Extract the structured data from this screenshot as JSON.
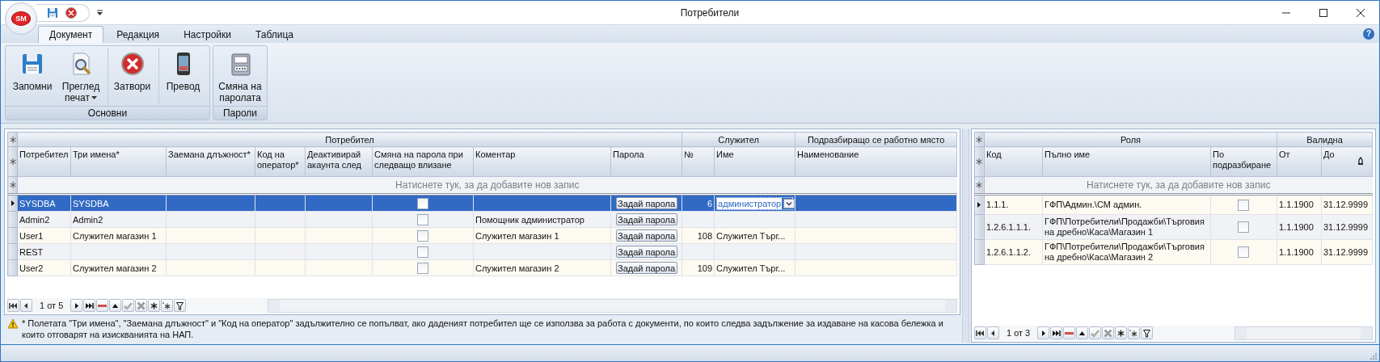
{
  "window": {
    "title": "Потребители"
  },
  "app_button": {
    "label": "SM"
  },
  "help_button": {
    "label": "?"
  },
  "tabs": [
    {
      "label": "Документ",
      "selected": true
    },
    {
      "label": "Редакция",
      "selected": false
    },
    {
      "label": "Настройки",
      "selected": false
    },
    {
      "label": "Таблица",
      "selected": false
    }
  ],
  "ribbon_groups": [
    {
      "title": "Основни",
      "buttons": [
        {
          "label": "Запомни",
          "dropdown": false,
          "separator_before": false
        },
        {
          "label": "Преглед печат",
          "dropdown": true,
          "separator_before": false
        },
        {
          "label": "Затвори",
          "dropdown": false,
          "separator_before": true
        },
        {
          "label": "Превод",
          "dropdown": false,
          "separator_before": true
        }
      ]
    },
    {
      "title": "Пароли",
      "buttons": [
        {
          "label": "Смяна на паролата",
          "dropdown": false,
          "separator_before": false
        }
      ]
    }
  ],
  "users_grid": {
    "column_groups": [
      {
        "label": "Потребител",
        "columns": [
          "Потребител",
          "Три имена*",
          "Заемана длъжност*",
          "Код на оператор*",
          "Деактивирай акаунта след",
          "Смяна на парола при следващо влизане",
          "Коментар",
          "Парола"
        ]
      },
      {
        "label": "Служител",
        "columns": [
          "№",
          "Име"
        ]
      },
      {
        "label": "Подразбиращо се работно място",
        "columns": [
          "Наименование"
        ]
      }
    ],
    "new_row_prompt": "Натиснете тук, за да добавите нов запис",
    "rows": [
      {
        "current": true,
        "selected": true,
        "editing": true,
        "user": "SYSDBA",
        "full_name": "SYSDBA",
        "change_password": false,
        "password_button": "Задай парола",
        "number": "6",
        "employee_name": "администратор"
      },
      {
        "current": false,
        "selected": false,
        "editing": false,
        "user": "Admin2",
        "full_name": "Admin2",
        "change_password": false,
        "comment": "Помощник администратор",
        "password_button": "Задай парола"
      },
      {
        "current": false,
        "selected": false,
        "editing": false,
        "user": "User1",
        "full_name": "Служител магазин 1",
        "change_password": false,
        "comment": "Служител магазин 1",
        "password_button": "Задай парола",
        "number": "108",
        "employee_name": "Служител Търг..."
      },
      {
        "current": false,
        "selected": false,
        "editing": false,
        "user": "REST",
        "change_password": false,
        "password_button": "Задай парола"
      },
      {
        "current": false,
        "selected": false,
        "editing": false,
        "user": "User2",
        "full_name": "Служител магазин 2",
        "change_password": false,
        "comment": "Служител магазин 2",
        "password_button": "Задай парола",
        "number": "109",
        "employee_name": "Служител Търг..."
      }
    ],
    "navigator": {
      "position": "1 от 5"
    }
  },
  "note": "* Полетата \"Три имена\", \"Заемана длъжност\" и \"Код на оператор\" задължително се попълват, ако даденият потребител ще се използва за работа с документи, по които следва задължение за издаване на касова бележка и които отговарят на изискванията на НАП.",
  "roles_grid": {
    "column_groups": [
      {
        "label": "Роля",
        "columns": [
          "Код",
          "Пълно име",
          "По подразбиране"
        ]
      },
      {
        "label": "Валидна",
        "columns": [
          "От",
          "До"
        ]
      }
    ],
    "new_row_prompt": "Натиснете тук, за да добавите нов запис",
    "rows": [
      {
        "current": true,
        "selected": false,
        "code": "1.1.1.",
        "full_name": "ГФП\\Админ.\\СМ админ.",
        "default": false,
        "valid_from": "1.1.1900",
        "valid_to": "31.12.9999"
      },
      {
        "current": false,
        "selected": false,
        "code": "1.2.6.1.1.1.",
        "full_name": "ГФП\\Потребители\\Продажби\\Търговия на дребно\\Каса\\Магазин 1",
        "default": false,
        "valid_from": "1.1.1900",
        "valid_to": "31.12.9999"
      },
      {
        "current": false,
        "selected": false,
        "code": "1.2.6.1.1.2.",
        "full_name": "ГФП\\Потребители\\Продажби\\Търговия на дребно\\Каса\\Магазин 2",
        "default": false,
        "valid_from": "1.1.1900",
        "valid_to": "31.12.9999"
      }
    ],
    "navigator": {
      "position": "1 от 3"
    }
  }
}
